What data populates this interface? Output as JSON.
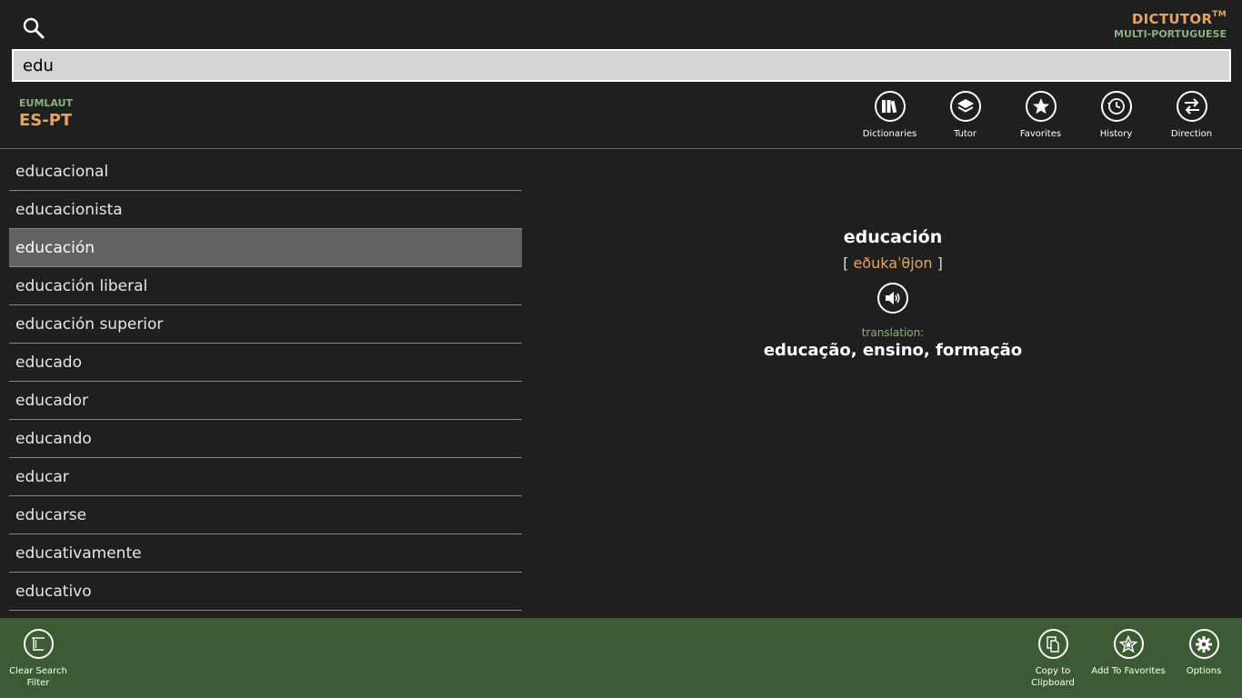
{
  "brand": {
    "title": "DICTUTOR",
    "tm": "TM",
    "subtitle": "MULTI-PORTUGUESE"
  },
  "search": {
    "value": "edu"
  },
  "dictionary": {
    "provider": "EUMLAUT",
    "pair": "ES-PT"
  },
  "toolbar": [
    {
      "label": "Dictionaries",
      "icon": "books-icon"
    },
    {
      "label": "Tutor",
      "icon": "layers-icon"
    },
    {
      "label": "Favorites",
      "icon": "star-icon"
    },
    {
      "label": "History",
      "icon": "clock-icon"
    },
    {
      "label": "Direction",
      "icon": "swap-arrows-icon"
    }
  ],
  "word_list": [
    "educacional",
    "educacionista",
    "educación",
    "educación liberal",
    "educación superior",
    "educado",
    "educador",
    "educando",
    "educar",
    "educarse",
    "educativamente",
    "educativo"
  ],
  "selected_index": 2,
  "entry": {
    "headword": "educación",
    "bracket_open": "[",
    "pronunciation": "eðukaˈθjon",
    "bracket_close": "]",
    "translation_label": "translation:",
    "translation": "educação, ensino, formação"
  },
  "appbar": {
    "clear_filter_l1": "Clear Search",
    "clear_filter_l2": "Filter",
    "copy_l1": "Copy to",
    "copy_l2": "Clipboard",
    "add_fav": "Add To Favorites",
    "options": "Options"
  },
  "colors": {
    "accent": "#e8a35f",
    "green_text": "#8cb07e",
    "appbar": "#3c5a33",
    "background": "#1f1f1f"
  }
}
